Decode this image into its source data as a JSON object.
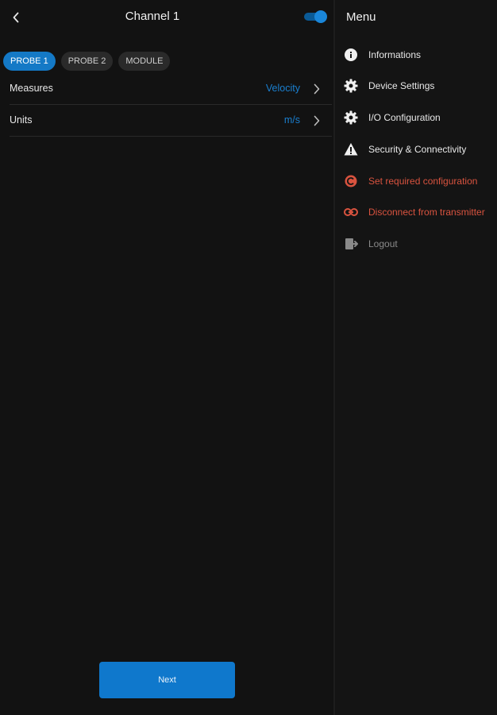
{
  "header": {
    "title": "Channel 1",
    "toggle_on": true
  },
  "tabs": [
    {
      "label": "PROBE 1",
      "active": true
    },
    {
      "label": "PROBE 2",
      "active": false
    },
    {
      "label": "MODULE",
      "active": false
    }
  ],
  "rows": [
    {
      "label": "Measures",
      "value": "Velocity"
    },
    {
      "label": "Units",
      "value": "m/s"
    }
  ],
  "footer": {
    "next_label": "Next"
  },
  "menu": {
    "title": "Menu",
    "items": [
      {
        "label": "Informations",
        "icon": "info-icon"
      },
      {
        "label": "Device Settings",
        "icon": "gear-icon"
      },
      {
        "label": "I/O Configuration",
        "icon": "gear-icon"
      },
      {
        "label": "Security & Connectivity",
        "icon": "warning-icon"
      },
      {
        "label": "Set required configuration",
        "icon": "config-reset-icon"
      },
      {
        "label": "Disconnect from transmitter",
        "icon": "unlink-icon"
      },
      {
        "label": "Logout",
        "icon": "logout-icon"
      }
    ]
  },
  "colors": {
    "accent": "#1479c6",
    "danger": "#d9533f",
    "background": "#121212",
    "muted": "#8a8a8a"
  }
}
